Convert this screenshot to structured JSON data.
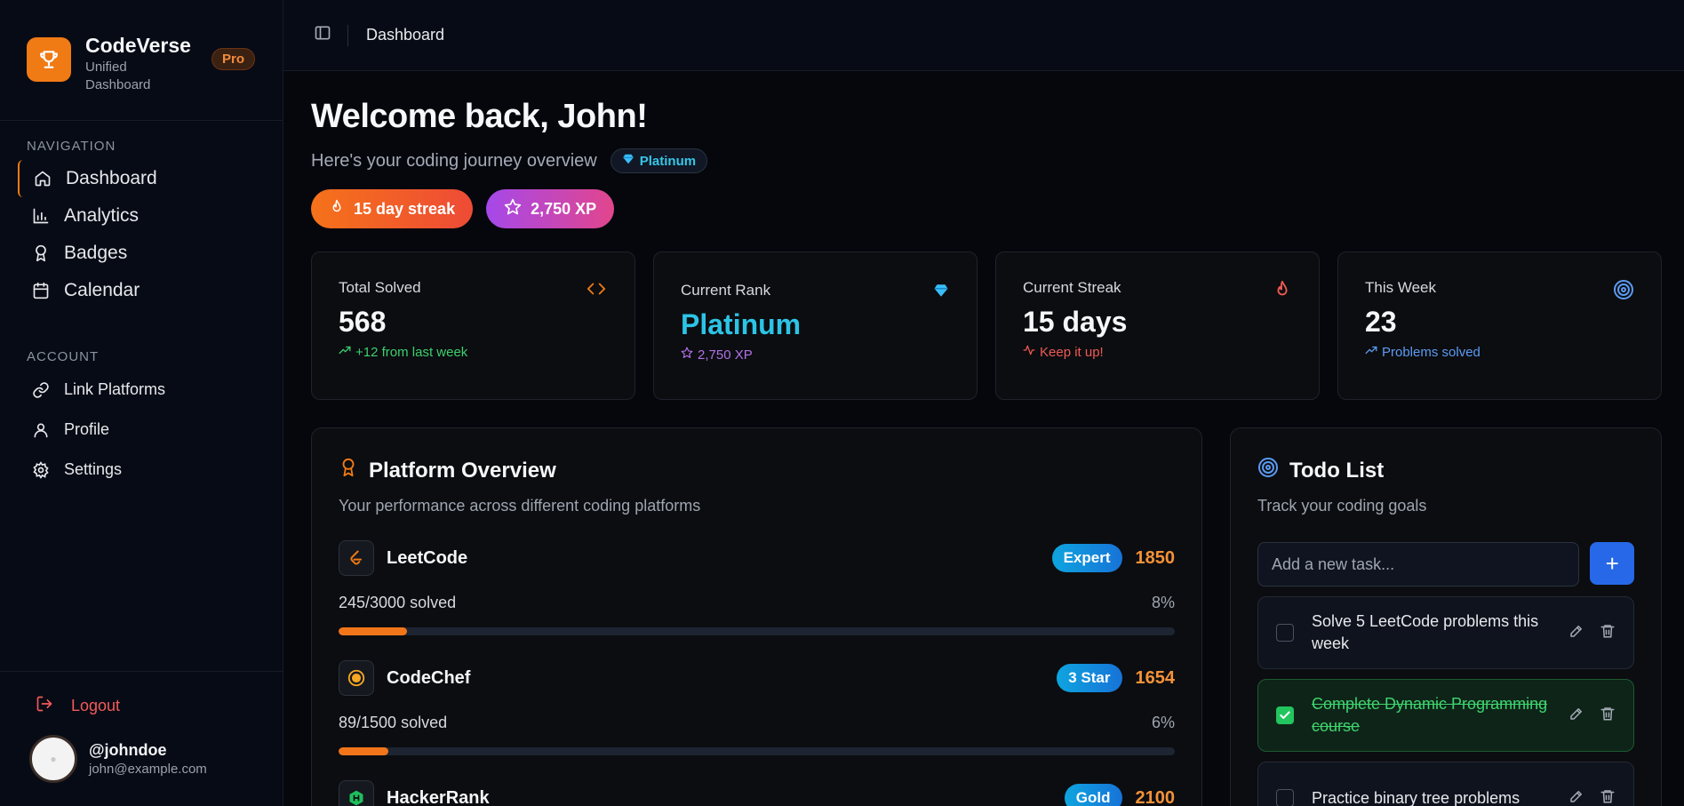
{
  "brand": {
    "name": "CodeVerse",
    "subtitle": "Unified Dashboard",
    "badge": "Pro"
  },
  "sidebar": {
    "nav_heading": "NAVIGATION",
    "nav_items": [
      {
        "label": "Dashboard",
        "icon": "home-icon",
        "active": true
      },
      {
        "label": "Analytics",
        "icon": "bar-chart-icon"
      },
      {
        "label": "Badges",
        "icon": "award-icon"
      },
      {
        "label": "Calendar",
        "icon": "calendar-icon"
      }
    ],
    "account_heading": "ACCOUNT",
    "account_items": [
      {
        "label": "Link Platforms",
        "icon": "link-icon"
      },
      {
        "label": "Profile",
        "icon": "user-icon"
      },
      {
        "label": "Settings",
        "icon": "gear-icon"
      }
    ],
    "logout": "Logout",
    "user": {
      "handle": "@johndoe",
      "email": "john@example.com"
    }
  },
  "topbar": {
    "breadcrumb": "Dashboard"
  },
  "header": {
    "welcome": "Welcome back, John!",
    "subtitle": "Here's your coding journey overview",
    "tier": "Platinum",
    "streak_chip": "15 day streak",
    "xp_chip": "2,750 XP"
  },
  "stats": [
    {
      "label": "Total Solved",
      "value": "568",
      "sub": "+12 from last week",
      "sub_color": "#3ccf6e"
    },
    {
      "label": "Current Rank",
      "value": "Platinum",
      "sub": "2,750 XP",
      "sub_color": "#b071e8"
    },
    {
      "label": "Current Streak",
      "value": "15 days",
      "sub": "Keep it up!",
      "sub_color": "#f05a54"
    },
    {
      "label": "This Week",
      "value": "23",
      "sub": "Problems solved",
      "sub_color": "#5b9bf3"
    }
  ],
  "platforms": {
    "title": "Platform Overview",
    "description": "Your performance across different coding platforms",
    "items": [
      {
        "name": "LeetCode",
        "level": "Expert",
        "rating": "1850",
        "solved": "245/3000 solved",
        "percent": "8%",
        "progress": 0.082
      },
      {
        "name": "CodeChef",
        "level": "3 Star",
        "rating": "1654",
        "solved": "89/1500 solved",
        "percent": "6%",
        "progress": 0.059
      },
      {
        "name": "HackerRank",
        "level": "Gold",
        "rating": "2100"
      }
    ]
  },
  "todo": {
    "title": "Todo List",
    "description": "Track your coding goals",
    "placeholder": "Add a new task...",
    "add_label": "+",
    "tasks": [
      {
        "text": "Solve 5 LeetCode problems this week",
        "done": false
      },
      {
        "text": "Complete Dynamic Programming course",
        "done": true
      },
      {
        "text": "Practice binary tree problems",
        "done": false
      }
    ]
  },
  "colors": {
    "accent": "#f07a14",
    "primary_blue": "#2668e8",
    "rank_cyan": "#2cc4e6"
  }
}
